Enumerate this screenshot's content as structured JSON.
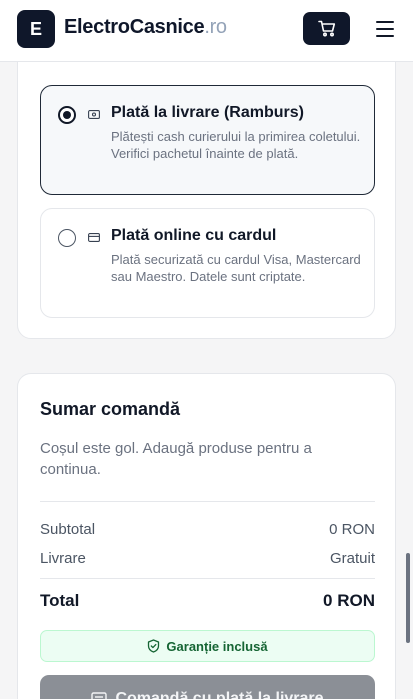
{
  "header": {
    "logo_letter": "E",
    "brand_name": "ElectroCasnice",
    "brand_tld": ".ro"
  },
  "payment": {
    "options": [
      {
        "title": "Plată la livrare (Ramburs)",
        "description": "Plătești cash curierului la primirea coletului. Verifici pachetul înainte de plată.",
        "selected": true
      },
      {
        "title": "Plată online cu cardul",
        "description": "Plată securizată cu cardul Visa, Mastercard sau Maestro. Datele sunt criptate.",
        "selected": false
      }
    ]
  },
  "summary": {
    "title": "Sumar comandă",
    "empty_message": "Coșul este gol. Adaugă produse pentru a continua.",
    "subtotal_label": "Subtotal",
    "subtotal_value": "0 RON",
    "delivery_label": "Livrare",
    "delivery_value": "Gratuit",
    "total_label": "Total",
    "total_value": "0 RON",
    "guarantee": "Garanție inclusă",
    "order_button": "Comandă cu plată la livrare"
  },
  "colors": {
    "primary": "#0f172a",
    "guarantee_bg": "#ecfdf3",
    "guarantee_text": "#166534",
    "button_disabled": "#8b8f96"
  },
  "icons": {
    "cart": "cart-icon",
    "menu": "menu-icon",
    "cash": "cash-icon",
    "card": "credit-card-icon",
    "shield": "shield-check-icon",
    "receipt": "receipt-icon"
  }
}
